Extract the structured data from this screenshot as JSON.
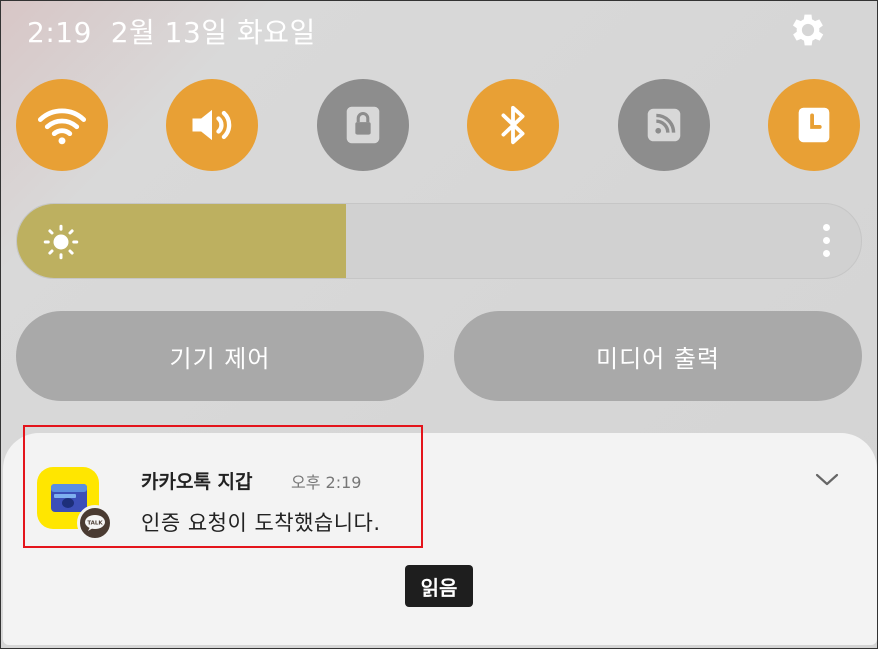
{
  "status_bar": {
    "time": "2:19",
    "date": "2월 13일 화요일"
  },
  "quick_settings": [
    {
      "name": "wifi",
      "state": "on",
      "icon": "wifi-icon"
    },
    {
      "name": "sound",
      "state": "on",
      "icon": "volume-icon"
    },
    {
      "name": "rotation-lock",
      "state": "off",
      "icon": "lock-icon"
    },
    {
      "name": "bluetooth",
      "state": "on",
      "icon": "bluetooth-icon"
    },
    {
      "name": "nfc",
      "state": "off",
      "icon": "nfc-icon"
    },
    {
      "name": "clock",
      "state": "on",
      "icon": "clock-icon"
    }
  ],
  "brightness": {
    "level": 0.39,
    "icon": "sun-icon"
  },
  "buttons": {
    "device_control": "기기 제어",
    "media_output": "미디어 출력"
  },
  "notification": {
    "app_name": "카카오톡 지갑",
    "time": "오후 2:19",
    "message": "인증 요청이 도착했습니다.",
    "badge_text": "TALK"
  },
  "tooltip": {
    "text": "읽음"
  },
  "colors": {
    "accent_on": "#e8a035",
    "tile_off": "#8d8d8d",
    "brightness_fill": "#bdb060",
    "highlight": "#e4141b",
    "kakao_yellow": "#ffe600"
  }
}
